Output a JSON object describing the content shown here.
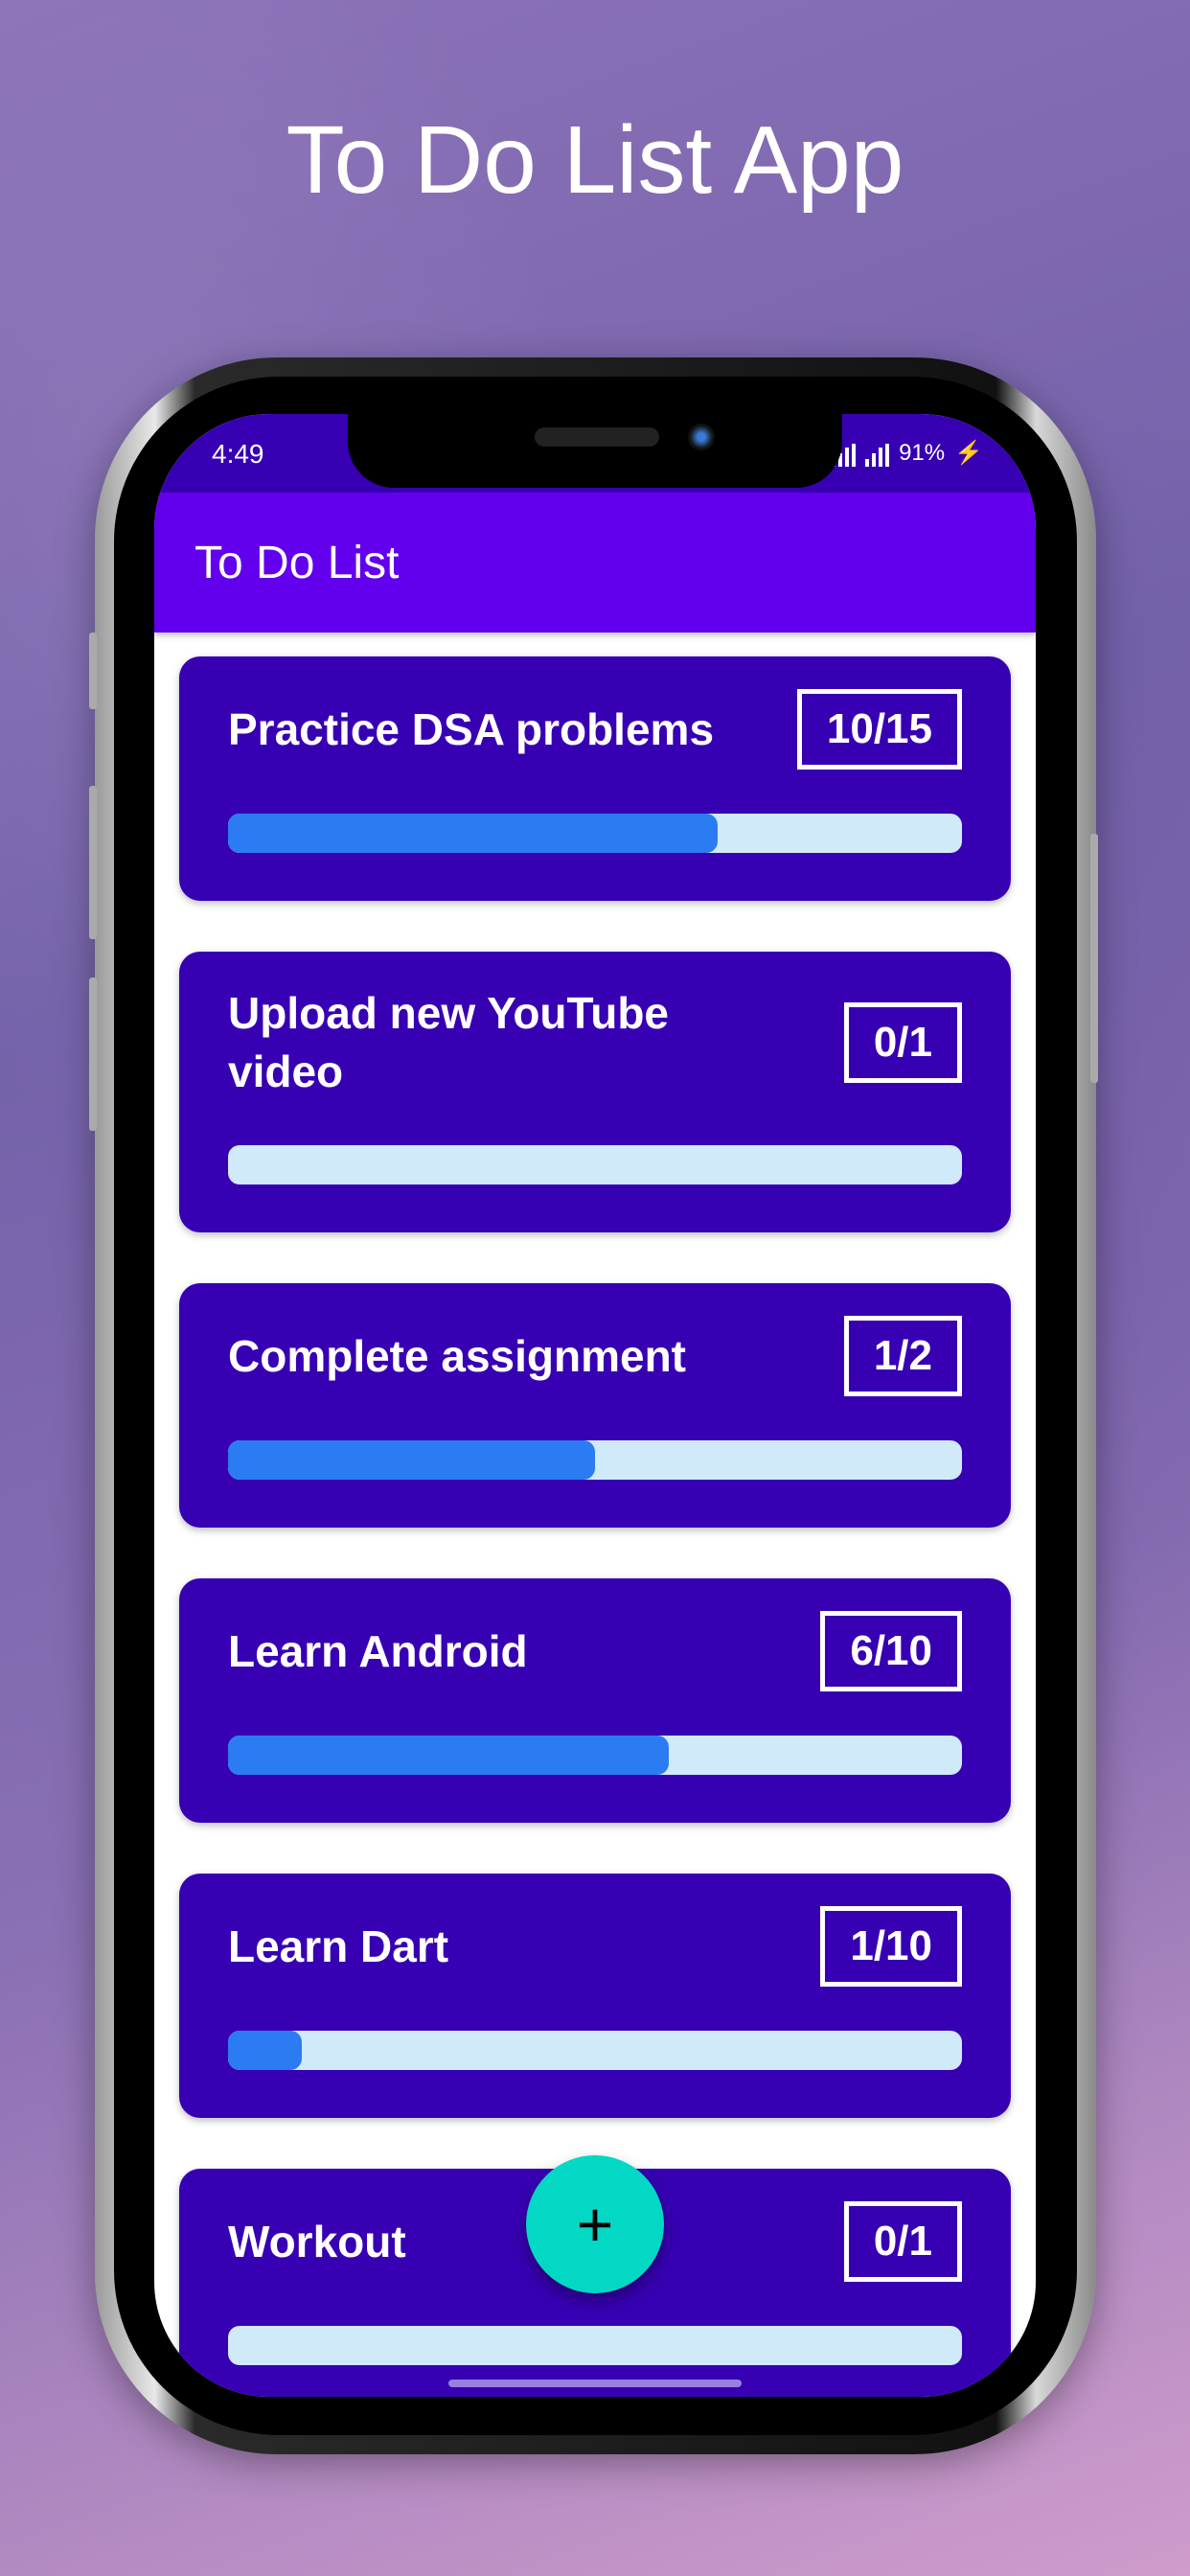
{
  "promo": {
    "title": "To Do List App"
  },
  "status_bar": {
    "time": "4:49",
    "battery": "91%"
  },
  "app_bar": {
    "title": "To Do List"
  },
  "tasks": [
    {
      "title": "Practice DSA problems",
      "count": "10/15",
      "progress": 0.667
    },
    {
      "title": "Upload new YouTube video",
      "count": "0/1",
      "progress": 0
    },
    {
      "title": "Complete assignment",
      "count": "1/2",
      "progress": 0.5
    },
    {
      "title": "Learn Android",
      "count": "6/10",
      "progress": 0.6
    },
    {
      "title": "Learn Dart",
      "count": "1/10",
      "progress": 0.1
    },
    {
      "title": "Workout",
      "count": "0/1",
      "progress": 0
    }
  ],
  "fab": {
    "icon": "plus-icon",
    "label": "+"
  },
  "colors": {
    "primary": "#6200EE",
    "primary_dark": "#3700B3",
    "accent": "#03DAC5",
    "progress": "#2B7BF2",
    "track": "#D1EAFA"
  }
}
